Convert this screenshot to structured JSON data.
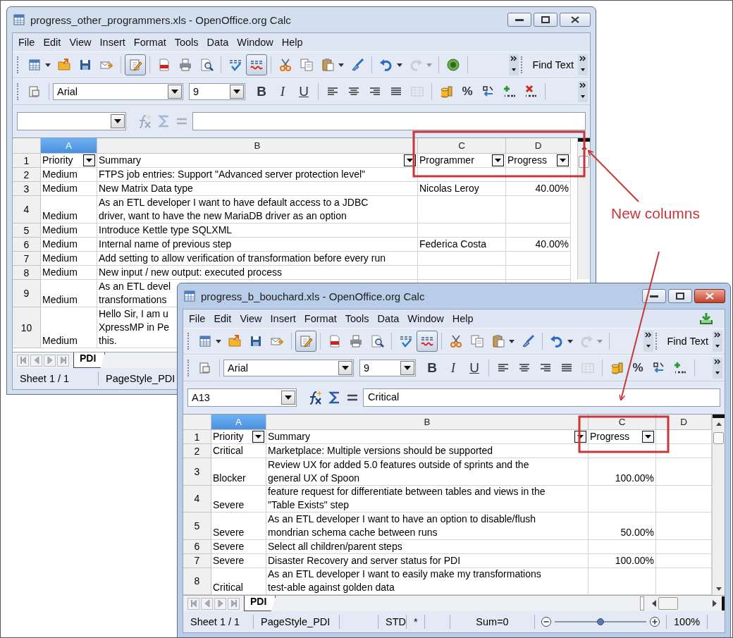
{
  "windows": [
    {
      "title": "progress_other_programmers.xls - OpenOffice.org Calc",
      "active": false,
      "update_available": false,
      "menu": [
        "File",
        "Edit",
        "View",
        "Insert",
        "Format",
        "Tools",
        "Data",
        "Window",
        "Help"
      ],
      "toolbar": [
        [
          {
            "kind": "new",
            "pressed": false,
            "disabled": false
          },
          {
            "kind": "dropdown",
            "pressed": false,
            "disabled": false
          },
          {
            "kind": "open",
            "pressed": false,
            "disabled": false
          },
          {
            "kind": "save",
            "pressed": false,
            "disabled": false
          },
          {
            "kind": "email",
            "pressed": false,
            "disabled": false
          }
        ],
        [
          {
            "kind": "edit",
            "pressed": true,
            "disabled": false
          }
        ],
        [
          {
            "kind": "pdf",
            "pressed": false,
            "disabled": false
          },
          {
            "kind": "print",
            "pressed": false,
            "disabled": false
          },
          {
            "kind": "preview",
            "pressed": false,
            "disabled": false
          }
        ],
        [
          {
            "kind": "spellcheck",
            "pressed": false,
            "disabled": false
          },
          {
            "kind": "autospell",
            "pressed": true,
            "disabled": false
          }
        ],
        [
          {
            "kind": "cut",
            "pressed": false,
            "disabled": false
          },
          {
            "kind": "copy",
            "pressed": false,
            "disabled": false
          },
          {
            "kind": "paste",
            "pressed": false,
            "disabled": false
          },
          {
            "kind": "dropdown",
            "pressed": false,
            "disabled": false
          },
          {
            "kind": "brush",
            "pressed": false,
            "disabled": false
          }
        ],
        [
          {
            "kind": "undo",
            "pressed": false,
            "disabled": false
          },
          {
            "kind": "dropdown",
            "pressed": false,
            "disabled": false
          },
          {
            "kind": "redo",
            "pressed": false,
            "disabled": true
          },
          {
            "kind": "dropdown",
            "pressed": false,
            "disabled": true
          }
        ],
        [
          {
            "kind": "navigator",
            "pressed": false,
            "disabled": false
          }
        ]
      ],
      "find_text": "Find Text",
      "font": "Arial",
      "size": "9",
      "text_styles": [
        "B",
        "I",
        "U"
      ],
      "align": [
        {
          "kind": "align-left",
          "disabled": false
        },
        {
          "kind": "align-center",
          "disabled": false
        },
        {
          "kind": "align-right",
          "disabled": false
        },
        {
          "kind": "justify",
          "disabled": false
        },
        {
          "kind": "merge",
          "disabled": true
        }
      ],
      "number": [
        {
          "kind": "currency"
        },
        {
          "kind": "percent",
          "label": "%"
        },
        {
          "kind": "standard"
        },
        {
          "kind": "add-decimal"
        },
        {
          "kind": "delete-decimal"
        }
      ],
      "formula_enabled": false,
      "columns": [
        {
          "label": "A",
          "selected": true,
          "align_right": false
        },
        {
          "label": "B",
          "selected": false,
          "align_right": false
        },
        {
          "label": "C",
          "selected": false,
          "align_right": false
        },
        {
          "label": "D",
          "selected": false,
          "align_right": true
        }
      ],
      "rows": [
        {
          "number": "1",
          "autofilter": true,
          "cells": [
            "Priority",
            "Summary",
            "Programmer",
            "Progress"
          ]
        },
        {
          "number": "2",
          "autofilter": false,
          "cells": [
            "Medium",
            "FTPS job entries: Support \"Advanced server protection level\"",
            null,
            null
          ]
        },
        {
          "number": "3",
          "autofilter": false,
          "cells": [
            "Medium",
            "New Matrix Data type",
            "Nicolas Leroy",
            "40.00%"
          ]
        },
        {
          "number": "4",
          "autofilter": false,
          "cells": [
            "Medium",
            "As an ETL developer I want to have default access to a JDBC\ndriver, want to have the new MariaDB driver as an option",
            null,
            null
          ]
        },
        {
          "number": "5",
          "autofilter": false,
          "cells": [
            "Medium",
            "Introduce Kettle type SQLXML",
            null,
            null
          ]
        },
        {
          "number": "6",
          "autofilter": false,
          "cells": [
            "Medium",
            "Internal name of previous step",
            "Federica Costa",
            "40.00%"
          ]
        },
        {
          "number": "7",
          "autofilter": false,
          "cells": [
            "Medium",
            "Add setting to allow verification of transformation before every run",
            null,
            null
          ]
        },
        {
          "number": "8",
          "autofilter": false,
          "cells": [
            "Medium",
            "New input / new output: executed process",
            null,
            null
          ]
        },
        {
          "number": "9",
          "autofilter": false,
          "cells": [
            "Medium",
            "As an ETL devel\ntransformations",
            null,
            null
          ]
        },
        {
          "number": "10",
          "autofilter": false,
          "cells": [
            "Medium",
            "Hello Sir, I am u\nXpressMP in Pe\nthis."
          ]
        }
      ],
      "sheet_tab": "PDI",
      "status": [
        {
          "kind": "text",
          "text": "Sheet 1 / 1"
        },
        {
          "kind": "text",
          "text": "PageStyle_PDI"
        }
      ]
    },
    {
      "title": "progress_b_bouchard.xls - OpenOffice.org Calc",
      "active": true,
      "update_available": true,
      "menu": [
        "File",
        "Edit",
        "View",
        "Insert",
        "Format",
        "Tools",
        "Data",
        "Window",
        "Help"
      ],
      "toolbar": [
        [
          {
            "kind": "new",
            "pressed": false,
            "disabled": false
          },
          {
            "kind": "dropdown",
            "pressed": false,
            "disabled": false
          },
          {
            "kind": "open",
            "pressed": false,
            "disabled": false
          },
          {
            "kind": "save",
            "pressed": false,
            "disabled": false
          },
          {
            "kind": "email",
            "pressed": false,
            "disabled": false
          }
        ],
        [
          {
            "kind": "edit",
            "pressed": true,
            "disabled": false
          }
        ],
        [
          {
            "kind": "pdf",
            "pressed": false,
            "disabled": false
          },
          {
            "kind": "print",
            "pressed": false,
            "disabled": false
          },
          {
            "kind": "preview",
            "pressed": false,
            "disabled": false
          }
        ],
        [
          {
            "kind": "spellcheck",
            "pressed": false,
            "disabled": false
          },
          {
            "kind": "autospell",
            "pressed": true,
            "disabled": false
          }
        ],
        [
          {
            "kind": "cut",
            "pressed": false,
            "disabled": false
          },
          {
            "kind": "copy",
            "pressed": false,
            "disabled": false
          },
          {
            "kind": "paste",
            "pressed": false,
            "disabled": false
          },
          {
            "kind": "dropdown",
            "pressed": false,
            "disabled": false
          },
          {
            "kind": "brush",
            "pressed": false,
            "disabled": false
          }
        ],
        [
          {
            "kind": "undo",
            "pressed": false,
            "disabled": false
          },
          {
            "kind": "dropdown",
            "pressed": false,
            "disabled": false
          },
          {
            "kind": "redo",
            "pressed": false,
            "disabled": true
          },
          {
            "kind": "dropdown",
            "pressed": false,
            "disabled": true
          }
        ]
      ],
      "find_text": "Find Text",
      "font": "Arial",
      "size": "9",
      "text_styles": [
        "B",
        "I",
        "U"
      ],
      "align": [
        {
          "kind": "align-left",
          "disabled": false
        },
        {
          "kind": "align-center",
          "disabled": false
        },
        {
          "kind": "align-right",
          "disabled": false
        },
        {
          "kind": "justify",
          "disabled": false
        },
        {
          "kind": "merge",
          "disabled": true
        }
      ],
      "number": [
        {
          "kind": "currency"
        },
        {
          "kind": "percent",
          "label": "%"
        },
        {
          "kind": "standard"
        },
        {
          "kind": "add-decimal"
        }
      ],
      "name_box": "A13",
      "formula": "Critical",
      "formula_enabled": true,
      "columns": [
        {
          "label": "A",
          "selected": true,
          "align_right": false
        },
        {
          "label": "B",
          "selected": false,
          "align_right": false
        },
        {
          "label": "C",
          "selected": false,
          "align_right": true
        },
        {
          "label": "D",
          "selected": false
        }
      ],
      "rows": [
        {
          "number": "1",
          "autofilter": true,
          "cells": [
            "Priority",
            "Summary",
            "Progress",
            null
          ]
        },
        {
          "number": "2",
          "autofilter": false,
          "cells": [
            "Critical",
            "Marketplace: Multiple versions should be supported",
            null,
            null
          ]
        },
        {
          "number": "3",
          "autofilter": false,
          "cells": [
            "Blocker",
            "Review UX for added 5.0 features outside of sprints and the\ngeneral UX of Spoon",
            "100.00%",
            null
          ]
        },
        {
          "number": "4",
          "autofilter": false,
          "cells": [
            "Severe",
            "feature request for differentiate between tables and views in the\n\"Table Exists\" step",
            null,
            null
          ]
        },
        {
          "number": "5",
          "autofilter": false,
          "cells": [
            "Severe",
            "As an ETL developer I want to have an option to disable/flush\nmondrian schema cache between runs",
            "50.00%",
            null
          ]
        },
        {
          "number": "6",
          "autofilter": false,
          "cells": [
            "Severe",
            "Select all children/parent steps",
            null,
            null
          ]
        },
        {
          "number": "7",
          "autofilter": false,
          "cells": [
            "Severe",
            "Disaster Recovery and server status for PDI",
            "100.00%",
            null
          ]
        },
        {
          "number": "8",
          "autofilter": false,
          "cells": [
            "Critical",
            "As an ETL developer I want to easily make my transformations\ntest-able against golden data",
            null,
            null
          ]
        }
      ],
      "sheet_tab": "PDI",
      "status": [
        {
          "kind": "text",
          "text": "Sheet 1 / 1"
        },
        {
          "kind": "text",
          "text": "PageStyle_PDI"
        },
        {
          "kind": "blank"
        },
        {
          "kind": "text",
          "text": "STD"
        },
        {
          "kind": "text",
          "text": "*"
        },
        {
          "kind": "blank"
        },
        {
          "kind": "text",
          "text": "Sum=0"
        },
        {
          "kind": "zoom",
          "level": 0.5
        },
        {
          "kind": "text",
          "text": "100%"
        }
      ]
    }
  ],
  "annotation": {
    "label": "New columns"
  }
}
